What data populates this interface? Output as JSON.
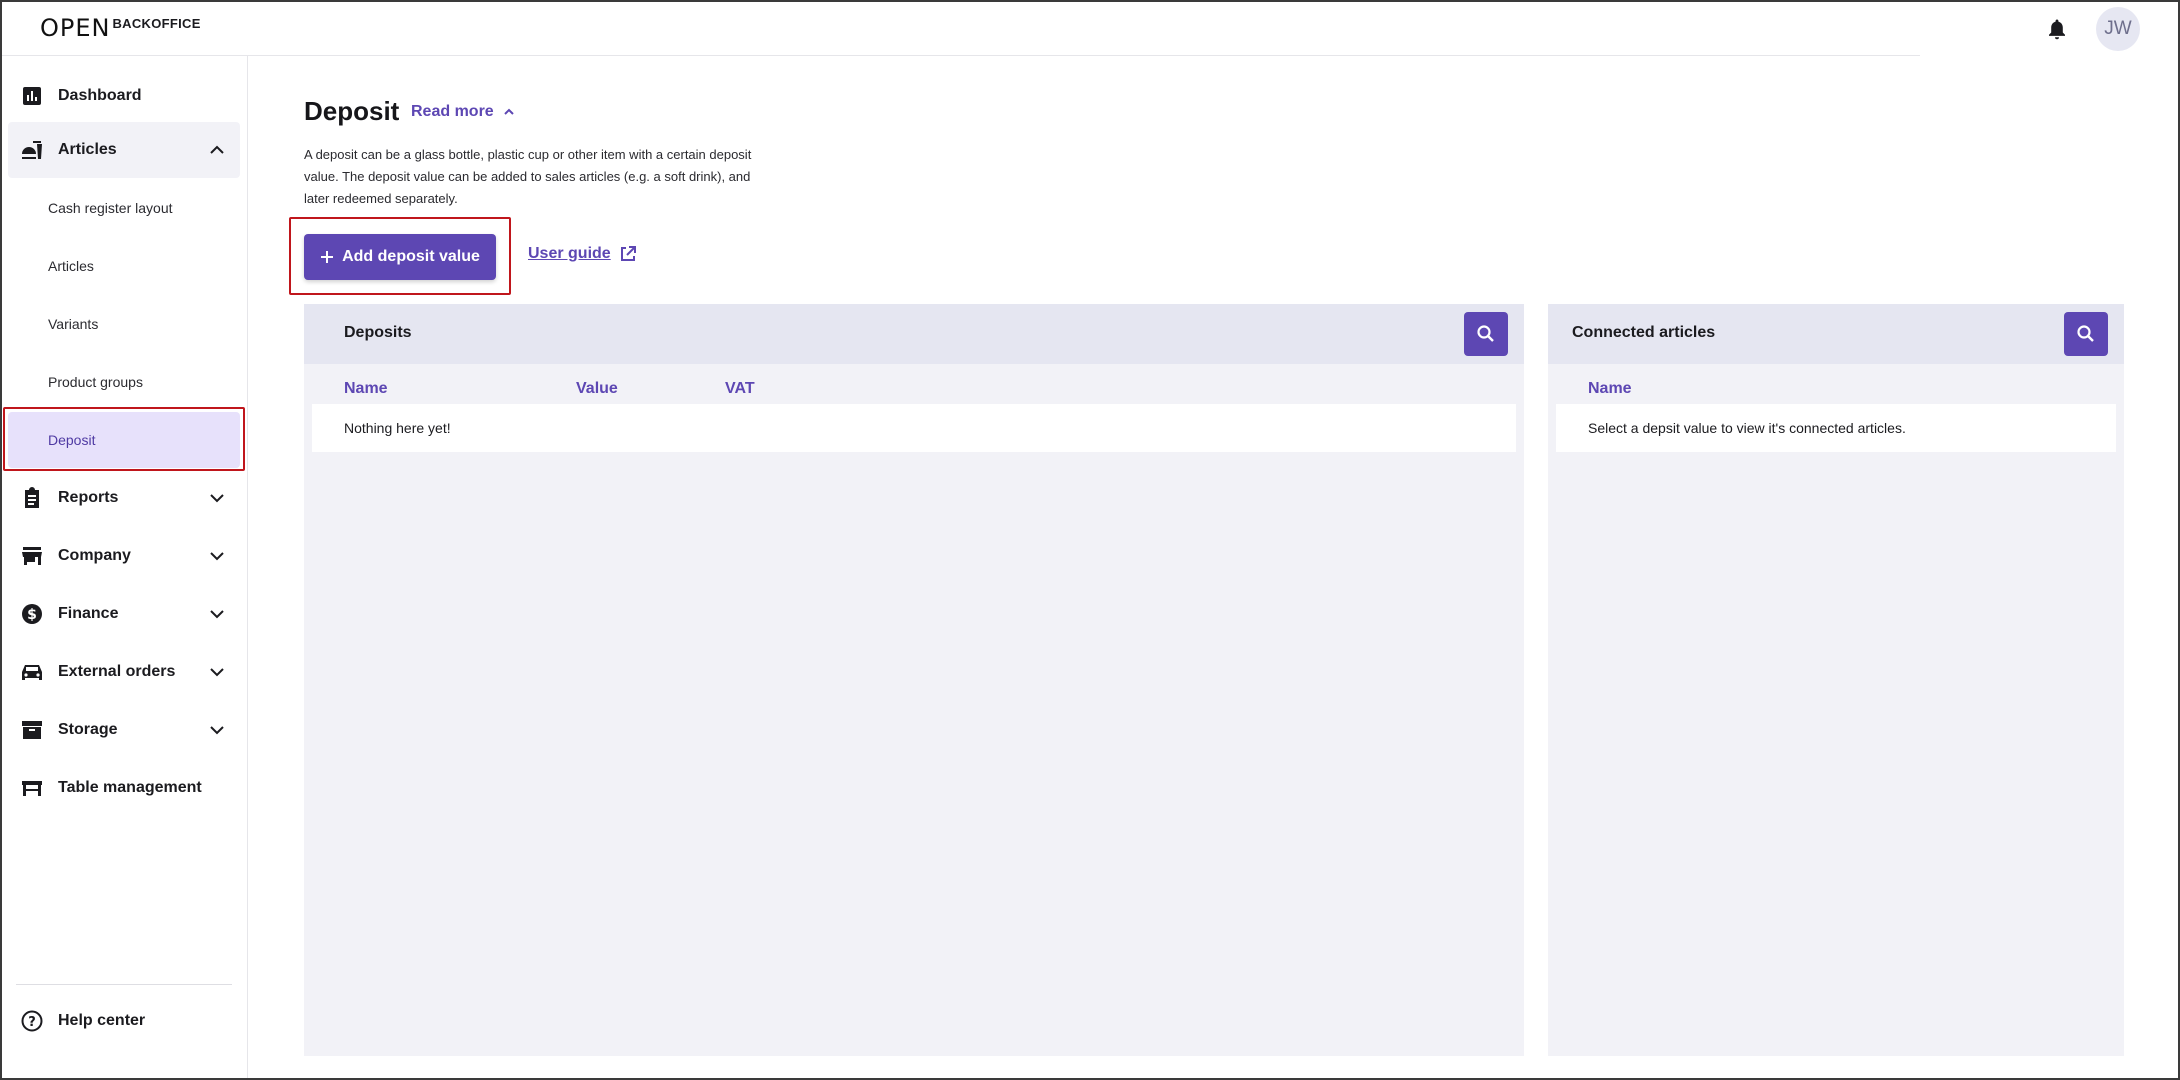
{
  "header": {
    "logo_mark": "OPEN",
    "logo_text": "BACKOFFICE",
    "avatar_initials": "JW"
  },
  "sidebar": {
    "items": [
      {
        "label": "Dashboard",
        "icon": "bar-chart-icon"
      },
      {
        "label": "Articles",
        "icon": "food-icon",
        "expanded": true
      },
      {
        "label": "Reports",
        "icon": "clipboard-icon"
      },
      {
        "label": "Company",
        "icon": "store-icon"
      },
      {
        "label": "Finance",
        "icon": "dollar-icon"
      },
      {
        "label": "External orders",
        "icon": "car-icon"
      },
      {
        "label": "Storage",
        "icon": "archive-icon"
      },
      {
        "label": "Table management",
        "icon": "table-icon"
      }
    ],
    "sub_items": [
      {
        "label": "Cash register layout"
      },
      {
        "label": "Articles"
      },
      {
        "label": "Variants"
      },
      {
        "label": "Product groups"
      },
      {
        "label": "Deposit",
        "active": true
      }
    ],
    "help": "Help center"
  },
  "main": {
    "title": "Deposit",
    "read_more": "Read more",
    "description": "A deposit can be a glass bottle, plastic cup or other item with a certain deposit value. The deposit value can be added to sales articles (e.g. a soft drink), and later redeemed separately.",
    "add_button": "Add deposit value",
    "user_guide": "User guide"
  },
  "deposits_panel": {
    "title": "Deposits",
    "columns": [
      "Name",
      "Value",
      "VAT"
    ],
    "empty_text": "Nothing here yet!"
  },
  "connected_panel": {
    "title": "Connected articles",
    "columns": [
      "Name"
    ],
    "empty_text": "Select a depsit value to view it's connected articles."
  },
  "colors": {
    "accent": "#5d47b3",
    "active_bg": "#e7e1fb",
    "highlight": "#c0161c"
  }
}
